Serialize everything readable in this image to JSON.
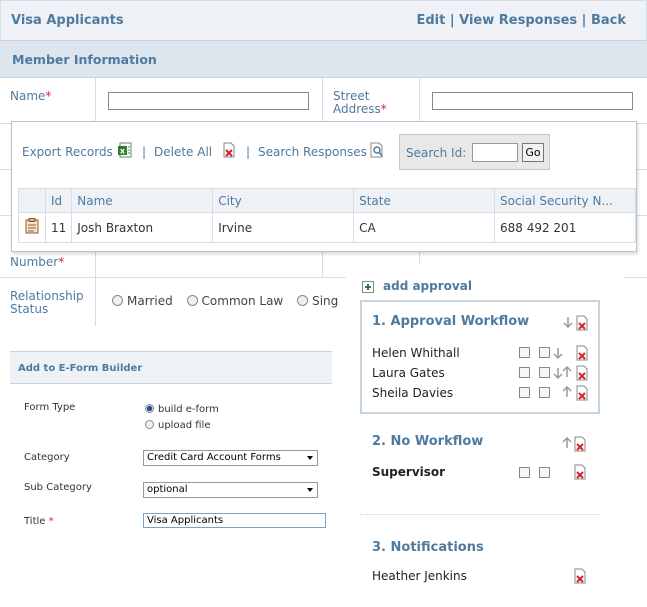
{
  "form": {
    "title": "Visa Applicants",
    "edit_link": "Edit",
    "view_responses_link": "View Responses",
    "back_link": "Back",
    "separator": "|",
    "section_title": "Member Information",
    "name_label": "Name",
    "street_label": "Street",
    "address_label": "Address",
    "number_label": "Number",
    "required_mark": "*",
    "relationship_label": "Relationship",
    "status_label": "Status",
    "relationship_options": [
      "Married",
      "Common Law",
      "Sing"
    ]
  },
  "export_panel": {
    "export_label": "Export Records",
    "delete_label": "Delete All",
    "search_label": "Search Responses",
    "separator": "|",
    "search_id_label": "Search Id:",
    "go_label": "Go",
    "columns": [
      "Id",
      "Name",
      "City",
      "State",
      "Social Security N..."
    ],
    "rows": [
      {
        "id": "11",
        "name": "Josh Braxton",
        "city": "Irvine",
        "state": "CA",
        "ssn": "688 492 201"
      }
    ]
  },
  "eform": {
    "header": "Add to E-Form Builder",
    "form_type_label": "Form Type",
    "form_type_options": [
      "build e-form",
      "upload file"
    ],
    "form_type_selected": "build e-form",
    "category_label": "Category",
    "category_value": "Credit Card Account Forms",
    "subcategory_label": "Sub Category",
    "subcategory_value": "optional",
    "title_label": "Title",
    "title_required": "*",
    "title_value": "Visa Applicants"
  },
  "approval": {
    "add_label": "add approval",
    "sections": [
      {
        "title": "1. Approval Workflow",
        "people": [
          "Helen Whithall",
          "Laura Gates",
          "Sheila Davies"
        ]
      },
      {
        "title": "2. No Workflow",
        "people": [
          "Supervisor"
        ]
      },
      {
        "title": "3. Notifications",
        "people": [
          "Heather Jenkins"
        ]
      }
    ]
  },
  "colors": {
    "accent": "#4f7a9f",
    "header_bg": "#eef2f6",
    "section_bg": "#dde6ee",
    "required": "#d9252a"
  }
}
